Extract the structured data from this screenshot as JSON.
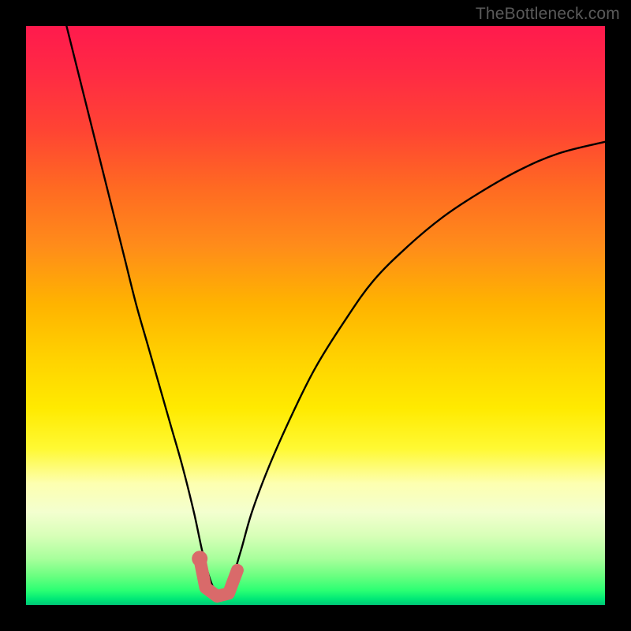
{
  "watermark": "TheBottleneck.com",
  "chart_data": {
    "type": "line",
    "title": "",
    "xlabel": "",
    "ylabel": "",
    "xlim": [
      0,
      100
    ],
    "ylim": [
      0,
      100
    ],
    "grid": false,
    "legend": false,
    "description": "Bottleneck curve; y is bottleneck percentage, background gradient red (high) to green (low). Valley near x≈31–36 reaches ≈0–3% where a pink marker sits.",
    "series": [
      {
        "name": "bottleneck-curve",
        "color": "#000000",
        "x": [
          7,
          9,
          11,
          13,
          15,
          17,
          19,
          21,
          23,
          25,
          27,
          29,
          31,
          33,
          35,
          37,
          39,
          42,
          46,
          50,
          55,
          60,
          66,
          72,
          78,
          85,
          92,
          100
        ],
        "y": [
          100,
          92,
          84,
          76,
          68,
          60,
          52,
          45,
          38,
          31,
          24,
          16,
          7,
          2,
          3,
          9,
          16,
          24,
          33,
          41,
          49,
          56,
          62,
          67,
          71,
          75,
          78,
          80
        ]
      }
    ],
    "marker": {
      "description": "Highlighted optimal range near valley bottom",
      "color": "#d96a6a",
      "points": [
        {
          "x": 30,
          "y": 8
        },
        {
          "x": 31,
          "y": 3
        },
        {
          "x": 33,
          "y": 1.5
        },
        {
          "x": 35,
          "y": 2
        },
        {
          "x": 36.5,
          "y": 6
        }
      ]
    }
  }
}
